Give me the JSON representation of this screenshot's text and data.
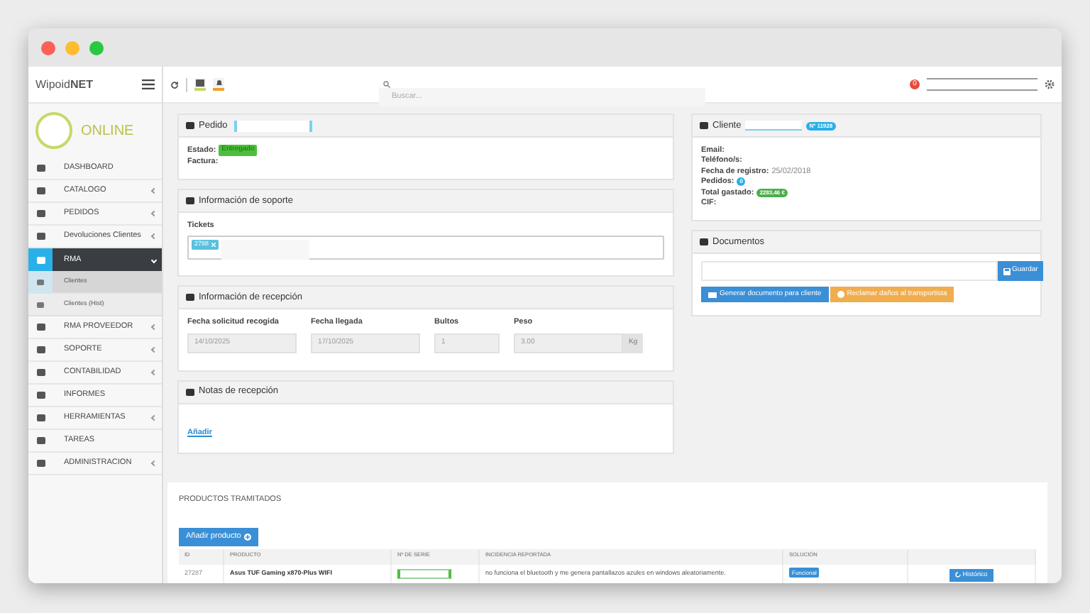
{
  "sidebar": {
    "logo": "Wipoid**NET**",
    "status": "ONLINE",
    "items": [
      {
        "label": "DASHBOARD",
        "submenu": false,
        "selected": false
      },
      {
        "label": "CATALOGO",
        "submenu": true,
        "selected": false
      },
      {
        "label": "PEDIDOS",
        "submenu": true,
        "selected": false
      },
      {
        "label": "Devoluciones Clientes",
        "submenu": true,
        "selected": false
      },
      {
        "label": "RMA",
        "submenu": true,
        "selected": true,
        "expanded": true,
        "children": [
          {
            "label": "Clientes",
            "selected": true
          },
          {
            "label": "Clientes (Hist)",
            "selected": false
          }
        ]
      },
      {
        "label": "RMA PROVEEDOR",
        "submenu": true,
        "selected": false
      },
      {
        "label": "SOPORTE",
        "submenu": true,
        "selected": false
      },
      {
        "label": "CONTABILIDAD",
        "submenu": true,
        "selected": false
      },
      {
        "label": "INFORMES",
        "submenu": false,
        "selected": false
      },
      {
        "label": "HERRAMIENTAS",
        "submenu": true,
        "selected": false
      },
      {
        "label": "TAREAS",
        "submenu": false,
        "selected": false
      },
      {
        "label": "ADMINISTRACION",
        "submenu": true,
        "selected": false
      }
    ]
  },
  "topbar": {
    "search_placeholder": "Buscar...",
    "notification_count": "0"
  },
  "pedido": {
    "title": "Pedido",
    "fields": [
      {
        "label": "Estado:",
        "badge": "Entregado"
      },
      {
        "label": "Factura:"
      }
    ]
  },
  "soporte": {
    "title": "Información de soporte",
    "label": "Tickets",
    "tags": [
      "2788"
    ]
  },
  "recepcion": {
    "title": "Información de recepción",
    "fields": [
      {
        "label": "Fecha solicitud recogida",
        "value": "14/10/2025"
      },
      {
        "label": "Fecha llegada",
        "value": "17/10/2025"
      },
      {
        "label": "Bultos",
        "value": "1"
      },
      {
        "label": "Peso",
        "value": "3.00",
        "unit": "Kg"
      }
    ]
  },
  "notas": {
    "title": "Notas de recepción",
    "link": "Añadir"
  },
  "cliente": {
    "title": "Cliente",
    "number_badge": "Nº 11928",
    "fields": [
      {
        "label": "Email:"
      },
      {
        "label": "Teléfono/s:"
      },
      {
        "label": "Fecha de registro:",
        "value": "25/02/2018"
      },
      {
        "label": "Pedidos:",
        "badge": "0",
        "color": "#2ab0e8"
      },
      {
        "label": "Total gastado:",
        "badge": "2283,46 €",
        "color": "#4cae4c"
      },
      {
        "label": "CIF:"
      }
    ]
  },
  "documentos": {
    "title": "Documentos",
    "save": "Guardar",
    "generate": "Generar documento para cliente",
    "claim": "Reclamar daños al transportista"
  },
  "productos": {
    "title": "PRODUCTOS TRAMITADOS",
    "add": "Añadir producto",
    "columns": [
      "ID",
      "PRODUCTO",
      "Nº DE SERIE",
      "INCIDENCIA REPORTADA",
      "SOLUCIÓN"
    ],
    "rows": [
      {
        "id": "27287",
        "product": "Asus TUF Gaming x870-Plus WIFI",
        "issue": "no funciona el bluetooth y me genera pantallazos azules en windows aleatoriamente.",
        "solution": "Funcional",
        "history": "Histórico"
      }
    ]
  }
}
